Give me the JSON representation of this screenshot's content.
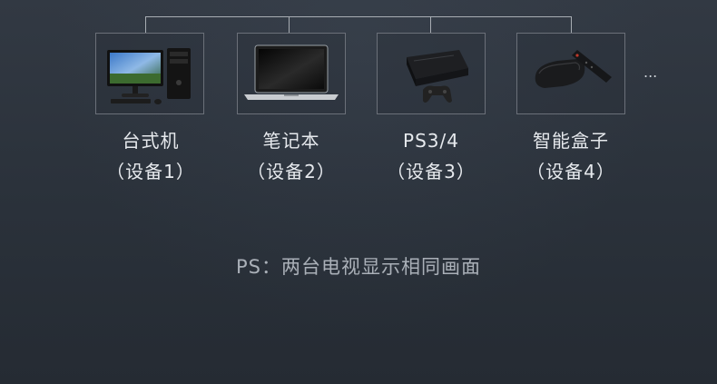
{
  "devices": [
    {
      "name": "台式机",
      "sub": "（设备1）",
      "icon": "desktop-computer-icon"
    },
    {
      "name": "笔记本",
      "sub": "（设备2）",
      "icon": "laptop-icon"
    },
    {
      "name": "PS3/4",
      "sub": "（设备3）",
      "icon": "game-console-icon"
    },
    {
      "name": "智能盒子",
      "sub": "（设备4）",
      "icon": "tv-box-icon"
    }
  ],
  "more": "...",
  "note": "PS：两台电视显示相同画面",
  "colors": {
    "background": "#2c333c",
    "text": "#e6e9ed",
    "note_text": "#aab0b8",
    "line": "#a8adb3"
  }
}
